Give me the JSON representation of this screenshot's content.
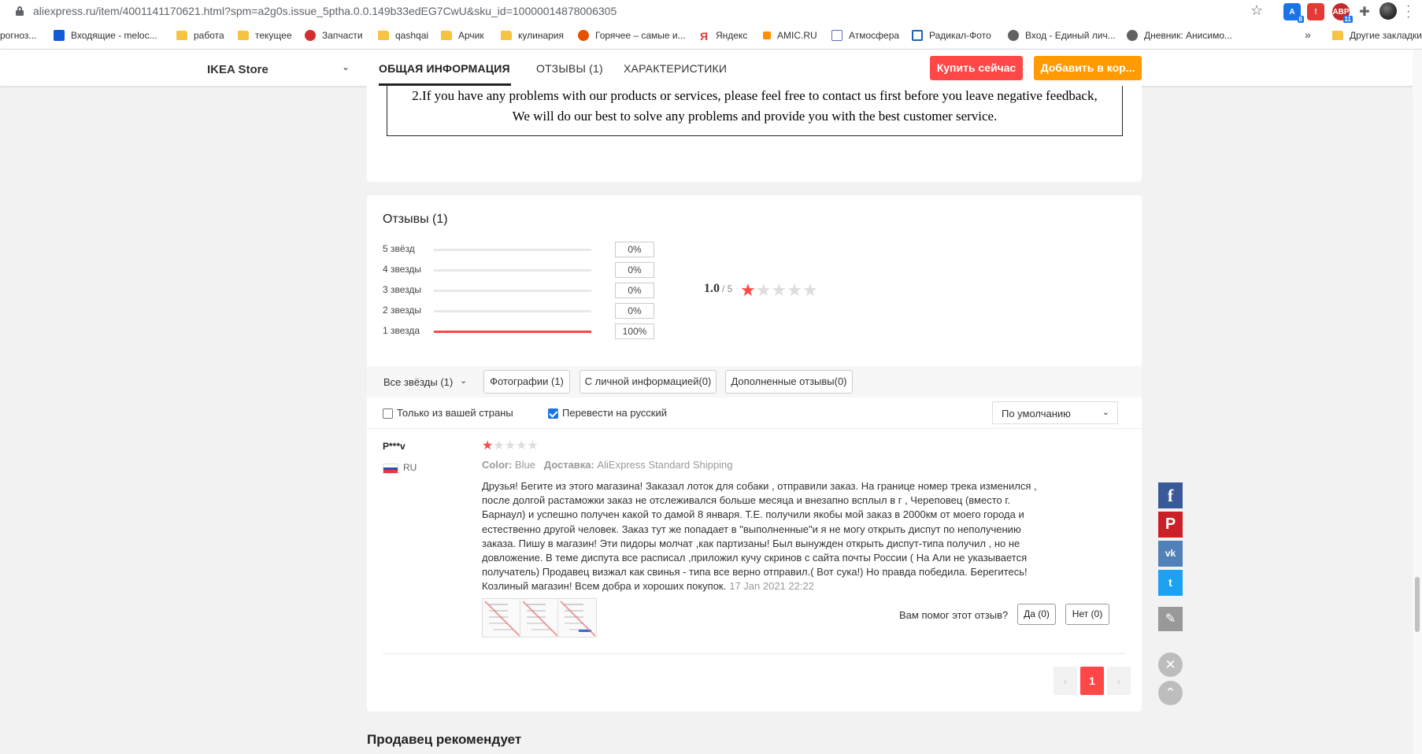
{
  "browser": {
    "url": "aliexpress.ru/item/4001141170621.html?spm=a2g0s.issue_5ptha.0.0.149b33edEG7CwU&sku_id=10000014878006305",
    "ext_badges": [
      "8",
      "",
      "11"
    ],
    "bookmarks": [
      "рогноз...",
      "Входящие - meloc...",
      "работа",
      "текущее",
      "Запчасти",
      "qashqai",
      "Арчик",
      "кулинария",
      "Горячее – самые и...",
      "Яндекс",
      "AMIC.RU",
      "Атмосфера",
      "Радикал-Фото",
      "Вход - Единый лич...",
      "Дневник: Анисимо...",
      "Другие закладки"
    ],
    "bookmarks_more": "»"
  },
  "nav": {
    "store": "IKEA Store",
    "tabs": [
      "ОБЩАЯ ИНФОРМАЦИЯ",
      "ОТЗЫВЫ (1)",
      "ХАРАКТЕРИСТИКИ"
    ],
    "buy_now": "Купить сейчас",
    "add_to_cart": "Добавить в кор..."
  },
  "description": {
    "line1": "2.If you have any problems with our products or services, please feel free to contact us first before you leave negative feedback,",
    "line2": "We will do our best to solve any problems and provide you with the best customer service."
  },
  "reviews": {
    "title": "Отзывы (1)",
    "distribution": [
      {
        "label": "5 звёзд",
        "pct": "0%",
        "fill": 0
      },
      {
        "label": "4 звезды",
        "pct": "0%",
        "fill": 0
      },
      {
        "label": "3 звезды",
        "pct": "0%",
        "fill": 0
      },
      {
        "label": "2 звезды",
        "pct": "0%",
        "fill": 0
      },
      {
        "label": "1 звезда",
        "pct": "100%",
        "fill": 1
      }
    ],
    "average": "1.0",
    "average_of": "/ 5",
    "average_stars": 1,
    "filters": {
      "all_stars": "Все звёзды (1)",
      "buttons": [
        "Фотографии (1)",
        "С личной информацией(0)",
        "Дополненные отзывы(0)"
      ],
      "only_country": "Только из вашей страны",
      "only_country_checked": false,
      "translate": "Перевести на русский",
      "translate_checked": true,
      "sort": "По умолчанию"
    },
    "items": [
      {
        "user": "P***v",
        "country": "RU",
        "stars": 1,
        "color_label": "Color:",
        "color_value": "Blue",
        "shipping_label": "Доставка:",
        "shipping_value": "AliExpress Standard Shipping",
        "text": "Друзья! Бегите из этого магазина! Заказал лоток для собаки , отправили заказ. На границе номер трека изменился , после долгой растаможки заказ не отслеживался больше месяца и внезапно всплыл в г , Череповец (вместо г. Барнаул) и успешно получен какой то дамой 8 января. Т.Е. получили якобы мой заказ в 2000км от моего города и естественно другой человек. Заказ тут же попадает в \"выполненные\"и я не могу открыть диспут по неполучению заказа. Пишу в магазин! Эти пидоры молчат ,как партизаны! Был вынужден открыть диспут-типа получил , но не довложение. В теме диспута все расписал ,приложил кучу скринов с сайта почты России ( На Али не указывается получатель) Продавец визжал как свинья - типа все верно отправил.( Вот сука!) Но правда победила. Берегитесь! Козлиный магазин! Всем добра и хороших покупок.",
        "date": "17 Jan 2021 22:22",
        "photos": 3,
        "helpful_q": "Вам помог этот отзыв?",
        "yes": "Да (0)",
        "no": "Нет (0)"
      }
    ],
    "pagination": {
      "prev": "‹",
      "current": "1",
      "next": "›"
    }
  },
  "seller_recommends": "Продавец рекомендует",
  "share": {
    "facebook": "f",
    "pinterest": "P",
    "vk": "vk",
    "twitter": "t"
  },
  "colors": {
    "accent_red": "#ff4747",
    "accent_orange": "#ff9a00"
  }
}
